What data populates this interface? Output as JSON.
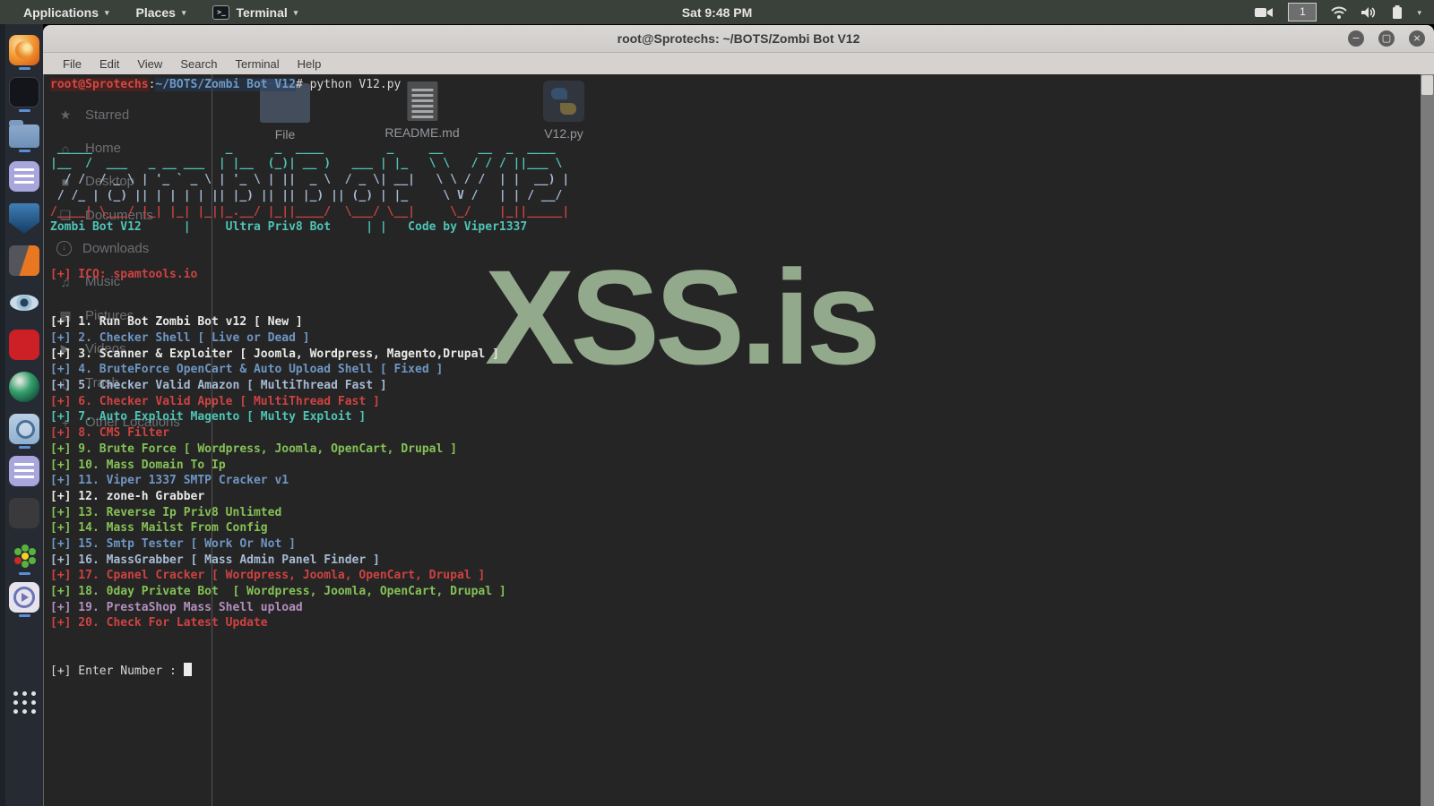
{
  "topbar": {
    "applications": "Applications",
    "places": "Places",
    "terminal": "Terminal",
    "clock": "Sat 9:48 PM",
    "workspace": "1",
    "right_icons": [
      "camera-icon",
      "workspace-indicator",
      "wifi-icon",
      "volume-icon",
      "battery-icon",
      "chevron-down-icon"
    ]
  },
  "window": {
    "title": "root@Sprotechs: ~/BOTS/Zombi Bot V12",
    "menus": [
      "File",
      "Edit",
      "View",
      "Search",
      "Terminal",
      "Help"
    ],
    "buttons": {
      "minimize": "−",
      "maximize": "▢",
      "close": "×"
    }
  },
  "terminal": {
    "prompt": {
      "user": "root@Sprotechs",
      "sep": ":",
      "path": "~/BOTS/Zombi Bot V12",
      "hash": "# ",
      "command": "python V12.py"
    },
    "ascii_art": [
      " _____                   _      _  ____         _     __     __  _  ____  ",
      "|__  /  ___   _ __ ___  | |__  (_)| __ )   ___ | |_   \\ \\   / / / ||___ \\ ",
      "  / /  / _ \\ | '_ ` _ \\ | '_ \\ | ||  _ \\  / _ \\| __|   \\ \\ / /  | |  __) |",
      " / /_ | (_) || | | | | || |_) || || |_) || (_) | |_     \\ V /   | | / __/ ",
      "/____| \\___/ |_| |_| |_||_.__/ |_||____/  \\___/ \\__|     \\_/    |_||_____|"
    ],
    "tagline": "Zombi Bot V12      |     Ultra Priv8 Bot     | |   Code by Viper1337",
    "icq_line": "[+] ICQ: spamtools.io",
    "menu": [
      {
        "text": "[+] 1. Run Bot Zombi Bot v12 [ New ]",
        "color": "white"
      },
      {
        "text": "[+] 2. Checker Shell [ Live or Dead ]",
        "color": "blue"
      },
      {
        "text": "[+] 3. Scanner & Exploiter [ Joomla, Wordpress, Magento,Drupal ]",
        "color": "white"
      },
      {
        "text": "[+] 4. BruteForce OpenCart & Auto Upload Shell [ Fixed ]",
        "color": "blue"
      },
      {
        "text": "[+] 5. Checker Valid Amazon [ MultiThread Fast ]",
        "color": "lblue"
      },
      {
        "text": "[+] 6. Checker Valid Apple [ MultiThread Fast ]",
        "color": "red"
      },
      {
        "text": "[+] 7. Auto Exploit Magento [ Multy Exploit ]",
        "color": "teal"
      },
      {
        "text": "[+] 8. CMS Filter",
        "color": "red"
      },
      {
        "text": "[+] 9. Brute Force [ Wordpress, Joomla, OpenCart, Drupal ]",
        "color": "green"
      },
      {
        "text": "[+] 10. Mass Domain To Ip",
        "color": "green"
      },
      {
        "text": "[+] 11. Viper 1337 SMTP Cracker v1",
        "color": "blue"
      },
      {
        "text": "[+] 12. zone-h Grabber",
        "color": "white"
      },
      {
        "text": "[+] 13. Reverse Ip Priv8 Unlimted",
        "color": "green"
      },
      {
        "text": "[+] 14. Mass Mailst From Config",
        "color": "green"
      },
      {
        "text": "[+] 15. Smtp Tester [ Work Or Not ]",
        "color": "blue"
      },
      {
        "text": "[+] 16. MassGrabber [ Mass Admin Panel Finder ]",
        "color": "lblue"
      },
      {
        "text": "[+] 17. Cpanel Cracker [ Wordpress, Joomla, OpenCart, Drupal ]",
        "color": "red"
      },
      {
        "text": "[+] 18. 0day Private Bot  [ Wordpress, Joomla, OpenCart, Drupal ]",
        "color": "green"
      },
      {
        "text": "[+] 19. PrestaShop Mass Shell upload",
        "color": "purple"
      },
      {
        "text": "[+] 20. Check For Latest Update",
        "color": "red"
      }
    ],
    "input_prompt": "[+] Enter Number : "
  },
  "watermark": "XSS.is",
  "filemanager_ghost": {
    "sidebar": [
      {
        "icon": "star-icon",
        "glyph": "★",
        "label": "Starred"
      },
      {
        "icon": "home-icon",
        "glyph": "⌂",
        "label": "Home"
      },
      {
        "icon": "desktop-icon",
        "glyph": "■",
        "label": "Desktop"
      },
      {
        "icon": "documents-icon",
        "glyph": "❏",
        "label": "Documents"
      },
      {
        "icon": "downloads-icon",
        "glyph": "↓",
        "label": "Downloads",
        "circle": true
      },
      {
        "icon": "music-icon",
        "glyph": "♫",
        "label": "Music"
      },
      {
        "icon": "pictures-icon",
        "glyph": "▦",
        "label": "Pictures"
      },
      {
        "icon": "videos-icon",
        "glyph": "▶",
        "label": "Videos"
      },
      {
        "icon": "trash-icon",
        "glyph": "▯",
        "label": "Trash"
      },
      {
        "icon": "other-locations-icon",
        "glyph": "+",
        "label": "Other Locations"
      }
    ],
    "files": [
      {
        "kind": "folder",
        "label": "File"
      },
      {
        "kind": "doc",
        "label": "README.md"
      },
      {
        "kind": "py",
        "label": "V12.py"
      }
    ]
  },
  "dock": [
    {
      "name": "firefox",
      "running": true
    },
    {
      "name": "terminal",
      "running": true
    },
    {
      "name": "files",
      "running": true
    },
    {
      "name": "text-editor",
      "running": false
    },
    {
      "name": "metasploit",
      "running": false
    },
    {
      "name": "burpsuite",
      "running": false
    },
    {
      "name": "ettercap",
      "running": false
    },
    {
      "name": "opera",
      "running": false
    },
    {
      "name": "globe-browser",
      "running": false
    },
    {
      "name": "web-browser",
      "running": true
    },
    {
      "name": "text-editor-2",
      "running": false
    },
    {
      "name": "sublime-text",
      "running": false
    },
    {
      "name": "icq",
      "running": true
    },
    {
      "name": "media-player",
      "running": true
    },
    {
      "name": "show-applications",
      "running": false
    }
  ],
  "colors": {
    "topbar_bg": "#3a403a",
    "terminal_bg": "#252525",
    "watermark": "#92a98c",
    "teal": "#4fc4b6",
    "red": "#ce4242",
    "green": "#85c156",
    "blue": "#6e96c4",
    "purple": "#b38fbe"
  }
}
